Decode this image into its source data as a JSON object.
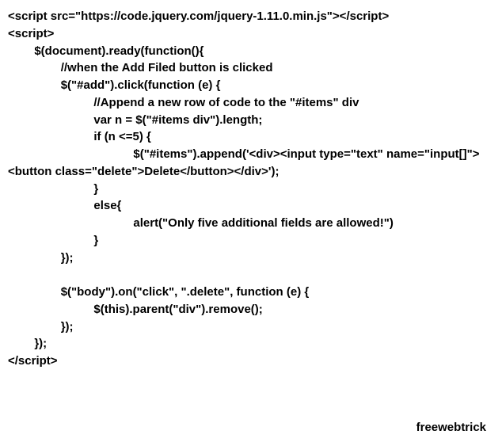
{
  "code": {
    "lines": [
      "<script src=\"https://code.jquery.com/jquery-1.11.0.min.js\"></script>",
      "<script>",
      "        $(document).ready(function(){",
      "                //when the Add Filed button is clicked",
      "                $(\"#add\").click(function (e) {",
      "                          //Append a new row of code to the \"#items\" div",
      "                          var n = $(\"#items div\").length;",
      "                          if (n <=5) {",
      "                                      $(\"#items\").append('<div><input type=\"text\" name=\"input[]\"><button class=\"delete\">Delete</button></div>');",
      "                          }",
      "                          else{",
      "                                      alert(\"Only five additional fields are allowed!\")",
      "                          }",
      "                });",
      "",
      "                $(\"body\").on(\"click\", \".delete\", function (e) {",
      "                          $(this).parent(\"div\").remove();",
      "                });",
      "        });",
      "</script>"
    ]
  },
  "watermark": "freewebtrick"
}
